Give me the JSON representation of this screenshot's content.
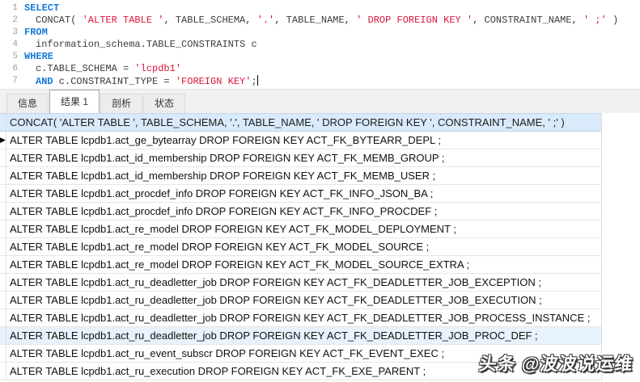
{
  "editor": {
    "lines": [
      {
        "num": "1",
        "indent": 0,
        "segments": [
          {
            "type": "kw",
            "text": "SELECT"
          }
        ]
      },
      {
        "num": "2",
        "indent": 1,
        "segments": [
          {
            "type": "plain",
            "text": "CONCAT( "
          },
          {
            "type": "str",
            "text": "'ALTER TABLE '"
          },
          {
            "type": "plain",
            "text": ", TABLE_SCHEMA, "
          },
          {
            "type": "str",
            "text": "'.'"
          },
          {
            "type": "plain",
            "text": ", TABLE_NAME, "
          },
          {
            "type": "str",
            "text": "' DROP FOREIGN KEY '"
          },
          {
            "type": "plain",
            "text": ", CONSTRAINT_NAME, "
          },
          {
            "type": "str",
            "text": "' ;'"
          },
          {
            "type": "plain",
            "text": " )"
          }
        ]
      },
      {
        "num": "3",
        "indent": 0,
        "segments": [
          {
            "type": "kw",
            "text": "FROM"
          }
        ]
      },
      {
        "num": "4",
        "indent": 1,
        "segments": [
          {
            "type": "plain",
            "text": "information_schema.TABLE_CONSTRAINTS c"
          }
        ]
      },
      {
        "num": "5",
        "indent": 0,
        "segments": [
          {
            "type": "kw",
            "text": "WHERE"
          }
        ]
      },
      {
        "num": "6",
        "indent": 1,
        "segments": [
          {
            "type": "plain",
            "text": "c.TABLE_SCHEMA = "
          },
          {
            "type": "str",
            "text": "'lcpdb1'"
          }
        ]
      },
      {
        "num": "7",
        "indent": 1,
        "cursor": true,
        "segments": [
          {
            "type": "kw",
            "text": "AND"
          },
          {
            "type": "plain",
            "text": " c.CONSTRAINT_TYPE = "
          },
          {
            "type": "str",
            "text": "'FOREIGN KEY'"
          },
          {
            "type": "plain",
            "text": ";"
          }
        ]
      }
    ]
  },
  "tabs": [
    {
      "name": "info",
      "label": "信息",
      "active": false
    },
    {
      "name": "result-1",
      "label": "结果 1",
      "active": true
    },
    {
      "name": "profile",
      "label": "剖析",
      "active": false
    },
    {
      "name": "status",
      "label": "状态",
      "active": false
    }
  ],
  "grid": {
    "header": "CONCAT( 'ALTER TABLE ', TABLE_SCHEMA, '.', TABLE_NAME, ' DROP FOREIGN KEY ', CONSTRAINT_NAME, ' ;' )",
    "current_row_index": 0,
    "highlighted_row_index": 11,
    "rows": [
      "ALTER TABLE lcpdb1.act_ge_bytearray DROP FOREIGN KEY ACT_FK_BYTEARR_DEPL ;",
      "ALTER TABLE lcpdb1.act_id_membership DROP FOREIGN KEY ACT_FK_MEMB_GROUP ;",
      "ALTER TABLE lcpdb1.act_id_membership DROP FOREIGN KEY ACT_FK_MEMB_USER ;",
      "ALTER TABLE lcpdb1.act_procdef_info DROP FOREIGN KEY ACT_FK_INFO_JSON_BA ;",
      "ALTER TABLE lcpdb1.act_procdef_info DROP FOREIGN KEY ACT_FK_INFO_PROCDEF ;",
      "ALTER TABLE lcpdb1.act_re_model DROP FOREIGN KEY ACT_FK_MODEL_DEPLOYMENT ;",
      "ALTER TABLE lcpdb1.act_re_model DROP FOREIGN KEY ACT_FK_MODEL_SOURCE ;",
      "ALTER TABLE lcpdb1.act_re_model DROP FOREIGN KEY ACT_FK_MODEL_SOURCE_EXTRA ;",
      "ALTER TABLE lcpdb1.act_ru_deadletter_job DROP FOREIGN KEY ACT_FK_DEADLETTER_JOB_EXCEPTION ;",
      "ALTER TABLE lcpdb1.act_ru_deadletter_job DROP FOREIGN KEY ACT_FK_DEADLETTER_JOB_EXECUTION ;",
      "ALTER TABLE lcpdb1.act_ru_deadletter_job DROP FOREIGN KEY ACT_FK_DEADLETTER_JOB_PROCESS_INSTANCE ;",
      "ALTER TABLE lcpdb1.act_ru_deadletter_job DROP FOREIGN KEY ACT_FK_DEADLETTER_JOB_PROC_DEF ;",
      "ALTER TABLE lcpdb1.act_ru_event_subscr DROP FOREIGN KEY ACT_FK_EVENT_EXEC ;",
      "ALTER TABLE lcpdb1.act_ru_execution DROP FOREIGN KEY ACT_FK_EXE_PARENT ;"
    ]
  },
  "watermark": "头条 @波波说运维",
  "colors": {
    "keyword": "#1779d9",
    "string": "#dc143c",
    "plain": "#3c3c3c",
    "linenum": "#9aa0a6",
    "headerbg": "#d9eafa",
    "rowhl": "#e7f2fd"
  }
}
